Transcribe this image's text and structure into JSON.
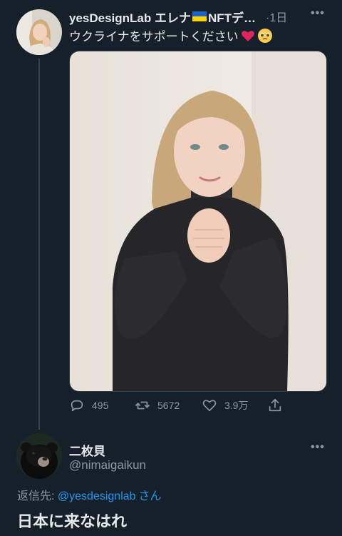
{
  "colors": {
    "background": "#15202b",
    "text": "#e7e9ea",
    "muted": "#8b98a5",
    "link": "#1d9bf0",
    "heart": "#e0245e",
    "flag_blue": "#1e63c6",
    "flag_yellow": "#ffd500"
  },
  "parent_tweet": {
    "author_name": "yesDesignLab エレナ",
    "author_name_suffix": "NFTデ…",
    "flag_icon": "ukraine-flag-icon",
    "time": "·1日",
    "text": "ウクライナをサポートください",
    "emoji_icons": [
      "red-heart-icon",
      "pleading-face-icon"
    ],
    "actions": {
      "reply_count": "495",
      "retweet_count": "5672",
      "like_count": "3.9万"
    }
  },
  "reply_tweet": {
    "author_name": "二枚貝",
    "handle": "@nimaigaikun",
    "reply_to_prefix": "返信先: ",
    "reply_to_handle": "@yesdesignlab",
    "reply_to_suffix": "さん",
    "text": "日本に来なはれ"
  }
}
